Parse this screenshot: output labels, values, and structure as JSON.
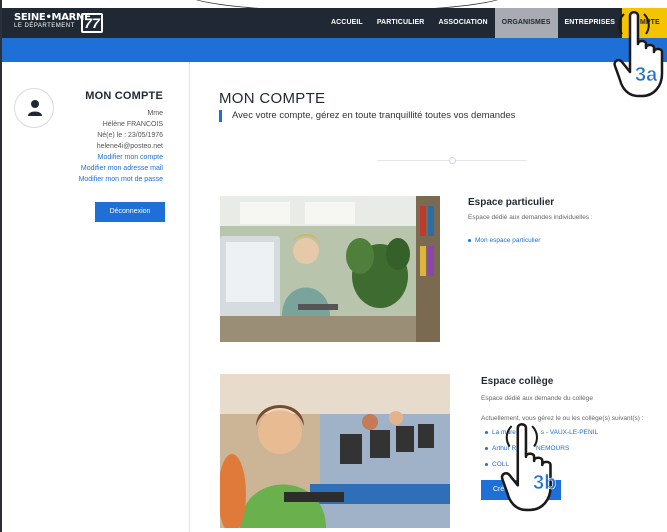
{
  "header": {
    "logo": {
      "name": "SEINE•MARNE",
      "sub": "LE DÉPARTEMENT",
      "number": "77"
    },
    "nav": [
      {
        "label": "ACCUEIL"
      },
      {
        "label": "PARTICULIER"
      },
      {
        "label": "ASSOCIATION"
      },
      {
        "label": "ORGANISMES"
      },
      {
        "label": "ENTREPRISES"
      },
      {
        "label": "MON COMPTE"
      }
    ],
    "active_label": "M    MPTE"
  },
  "sidebar": {
    "title": "MON COMPTE",
    "civility": "Mme",
    "name": "Hélène FRANCOIS",
    "birth": "Né(e) le : 23/05/1976",
    "email": "helene4i@posteo.net",
    "links": [
      "Modifier mon compte",
      "Modifier mon adresse mail",
      "Modifier mon mot de passe"
    ],
    "logout": "Déconnexion"
  },
  "main": {
    "title": "MON COMPTE",
    "subtitle": "Avec votre compte, gérez en toute tranquillité toutes vos demandes",
    "particulier": {
      "title": "Espace particulier",
      "desc": "Espace dédié aux demandes individuelles :",
      "link": "Mon espace particulier"
    },
    "college": {
      "title": "Espace collège",
      "desc": "Espace dédié aux demande du collège",
      "current": "Actuellement, vous gérez le ou les collège(s) suivant(s) :",
      "links": [
        "La mare a      s - VAUX-LE-PENIL",
        "Arthur Rim    NEMOURS",
        "COLL"
      ],
      "button": "Créer un c"
    }
  },
  "annotations": {
    "step_a": "3a",
    "step_b": "3b"
  },
  "colors": {
    "nav_bg": "#1f2833",
    "accent_blue": "#1e70d6",
    "active_yellow": "#f5c400"
  }
}
